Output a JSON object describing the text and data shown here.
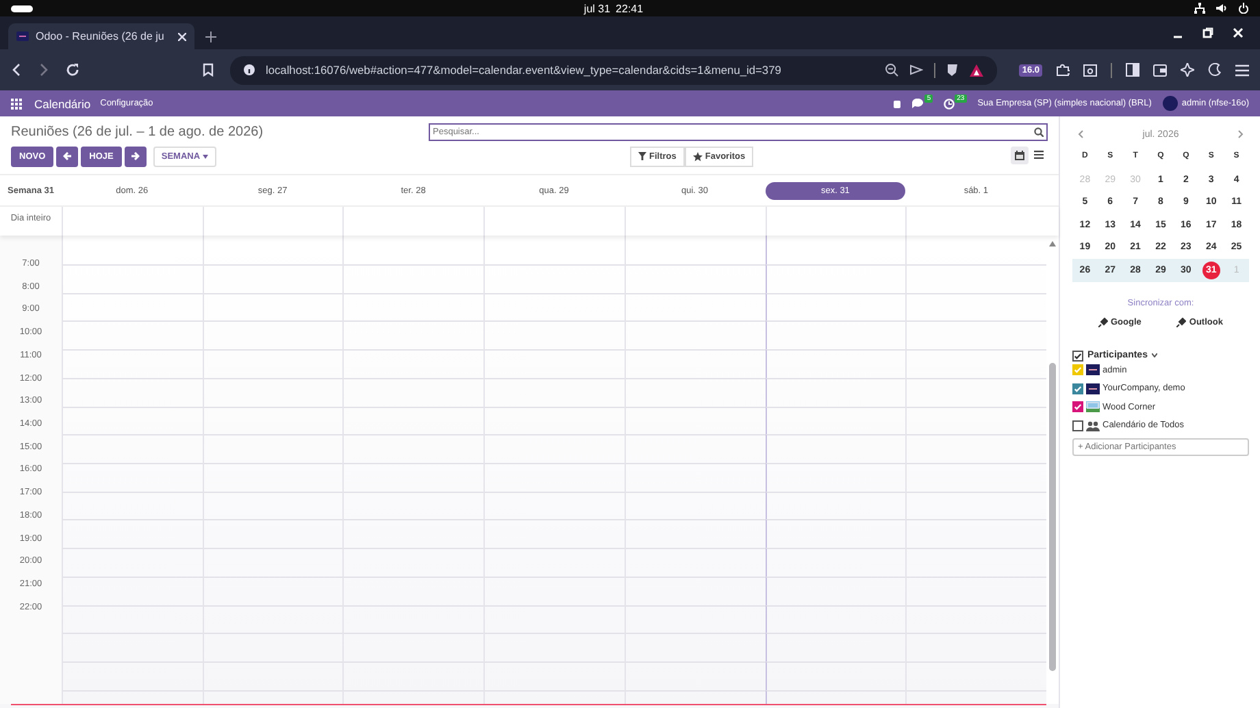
{
  "os_bar": {
    "date": "jul 31",
    "time": "22:41"
  },
  "browser": {
    "tab_title": "Odoo - Reuniões (26 de ju",
    "url": "localhost:16076/web#action=477&model=calendar.event&view_type=calendar&cids=1&menu_id=379",
    "extension_badge": "16.0"
  },
  "navbar": {
    "app": "Calendário",
    "menus": [
      "Configuração"
    ],
    "messages_count": "5",
    "activities_count": "23",
    "company": "Sua Empresa (SP) (simples nacional) (BRL)",
    "user": "admin (nfse-16o)"
  },
  "control_panel": {
    "title": "Reuniões (26 de jul. – 1 de ago. de 2026)",
    "buttons": [
      {
        "kind": "primary",
        "label": "NOVO"
      },
      {
        "kind": "prev"
      },
      {
        "kind": "primary",
        "label": "HOJE"
      },
      {
        "kind": "next"
      },
      {
        "kind": "dropdown",
        "label": "SEMANA"
      }
    ],
    "search": {
      "placeholder": "Pesquisar..."
    },
    "filters": [
      {
        "kind": "filter",
        "label": "Filtros"
      },
      {
        "kind": "star",
        "label": "Favoritos"
      }
    ],
    "views": [
      {
        "kind": "calendar",
        "selected": true
      },
      {
        "kind": "list",
        "selected": false
      }
    ]
  },
  "calendar": {
    "week_label": "Semana 31",
    "all_day_label": "Dia inteiro",
    "days": [
      {
        "label": "dom. 26",
        "selected": false
      },
      {
        "label": "seg. 27",
        "selected": false
      },
      {
        "label": "ter. 28",
        "selected": false
      },
      {
        "label": "qua. 29",
        "selected": false
      },
      {
        "label": "qui. 30",
        "selected": false
      },
      {
        "label": "sex. 31",
        "selected": true
      },
      {
        "label": "sáb. 1",
        "selected": false
      }
    ],
    "hours": [
      "7:00",
      "8:00",
      "9:00",
      "10:00",
      "11:00",
      "12:00",
      "13:00",
      "14:00",
      "15:00",
      "16:00",
      "17:00",
      "18:00",
      "19:00",
      "20:00",
      "21:00",
      "22:00"
    ]
  },
  "sidebar": {
    "month": "jul. 2026",
    "weekdays": [
      "D",
      "S",
      "T",
      "Q",
      "Q",
      "S",
      "S"
    ],
    "weeks": [
      {
        "current": false,
        "days": [
          {
            "label": "28",
            "muted": true,
            "today": false
          },
          {
            "label": "29",
            "muted": true,
            "today": false
          },
          {
            "label": "30",
            "muted": true,
            "today": false
          },
          {
            "label": "1",
            "muted": false,
            "today": false
          },
          {
            "label": "2",
            "muted": false,
            "today": false
          },
          {
            "label": "3",
            "muted": false,
            "today": false
          },
          {
            "label": "4",
            "muted": false,
            "today": false
          }
        ]
      },
      {
        "current": false,
        "days": [
          {
            "label": "5",
            "muted": false,
            "today": false
          },
          {
            "label": "6",
            "muted": false,
            "today": false
          },
          {
            "label": "7",
            "muted": false,
            "today": false
          },
          {
            "label": "8",
            "muted": false,
            "today": false
          },
          {
            "label": "9",
            "muted": false,
            "today": false
          },
          {
            "label": "10",
            "muted": false,
            "today": false
          },
          {
            "label": "11",
            "muted": false,
            "today": false
          }
        ]
      },
      {
        "current": false,
        "days": [
          {
            "label": "12",
            "muted": false,
            "today": false
          },
          {
            "label": "13",
            "muted": false,
            "today": false
          },
          {
            "label": "14",
            "muted": false,
            "today": false
          },
          {
            "label": "15",
            "muted": false,
            "today": false
          },
          {
            "label": "16",
            "muted": false,
            "today": false
          },
          {
            "label": "17",
            "muted": false,
            "today": false
          },
          {
            "label": "18",
            "muted": false,
            "today": false
          }
        ]
      },
      {
        "current": false,
        "days": [
          {
            "label": "19",
            "muted": false,
            "today": false
          },
          {
            "label": "20",
            "muted": false,
            "today": false
          },
          {
            "label": "21",
            "muted": false,
            "today": false
          },
          {
            "label": "22",
            "muted": false,
            "today": false
          },
          {
            "label": "23",
            "muted": false,
            "today": false
          },
          {
            "label": "24",
            "muted": false,
            "today": false
          },
          {
            "label": "25",
            "muted": false,
            "today": false
          }
        ]
      },
      {
        "current": true,
        "days": [
          {
            "label": "26",
            "muted": false,
            "today": false
          },
          {
            "label": "27",
            "muted": false,
            "today": false
          },
          {
            "label": "28",
            "muted": false,
            "today": false
          },
          {
            "label": "29",
            "muted": false,
            "today": false
          },
          {
            "label": "30",
            "muted": false,
            "today": false
          },
          {
            "label": "31",
            "muted": false,
            "today": true
          },
          {
            "label": "1",
            "muted": true,
            "today": false
          }
        ]
      }
    ],
    "sync_label": "Sincronizar com:",
    "sync_buttons": [
      "Google",
      "Outlook"
    ],
    "participants": {
      "label": "Participantes",
      "checked": true,
      "items": [
        {
          "name": "admin",
          "checked": true,
          "color": "#f0c800",
          "kind": "logo"
        },
        {
          "name": "YourCompany, demo",
          "checked": true,
          "color": "#3b879e",
          "kind": "logo"
        },
        {
          "name": "Wood Corner",
          "checked": true,
          "color": "#d6147a",
          "kind": "picture"
        },
        {
          "name": "Calendário de Todos",
          "checked": false,
          "kind": "group"
        }
      ],
      "add_placeholder": "+ Adicionar Participantes"
    }
  }
}
